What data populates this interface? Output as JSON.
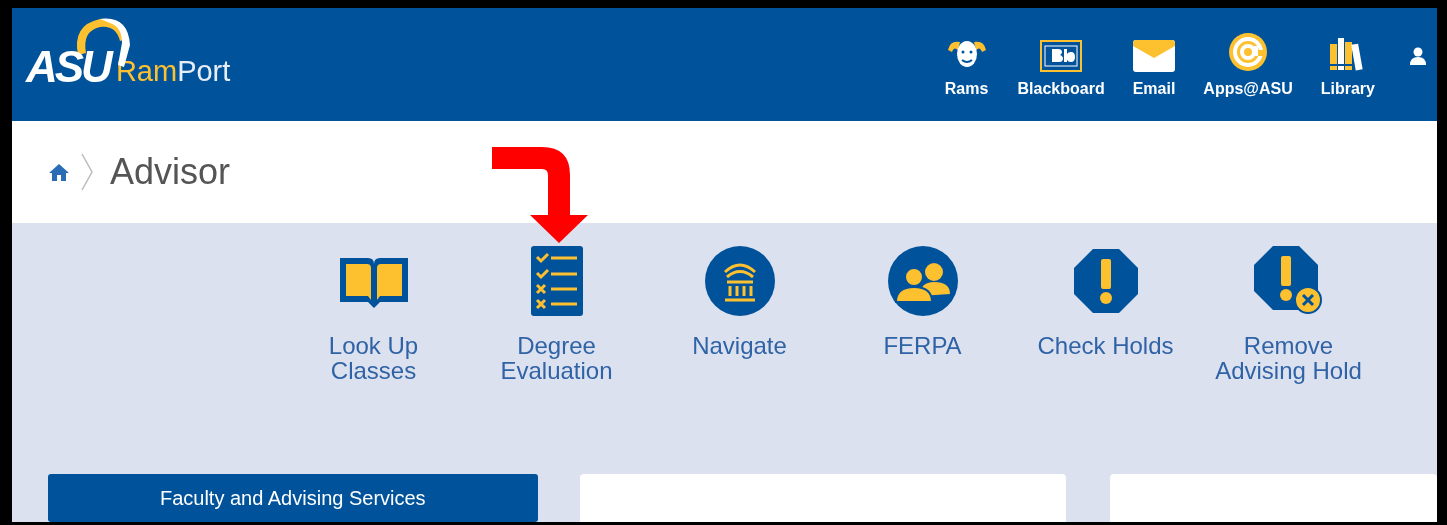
{
  "header": {
    "logo_text": "ASU",
    "app_name_first": "Ram",
    "app_name_second": "Port",
    "nav": [
      {
        "kind": "rams",
        "label": "Rams"
      },
      {
        "kind": "blackboard",
        "label": "Blackboard"
      },
      {
        "kind": "email",
        "label": "Email"
      },
      {
        "kind": "at",
        "label": "Apps@ASU"
      },
      {
        "kind": "library",
        "label": "Library"
      },
      {
        "kind": "user"
      }
    ]
  },
  "breadcrumb": {
    "title": "Advisor"
  },
  "tiles": [
    {
      "kind": "book",
      "label": "Look Up Classes"
    },
    {
      "kind": "checklist",
      "label": "Degree Evaluation"
    },
    {
      "kind": "columns",
      "label": "Navigate"
    },
    {
      "kind": "people",
      "label": "FERPA"
    },
    {
      "kind": "alert",
      "label": "Check Holds"
    },
    {
      "kind": "alert-x",
      "label": "Remove Advising Hold"
    }
  ],
  "annotation": {
    "kind": "curved-arrow"
  },
  "services_button": "Faculty and Advising Services"
}
